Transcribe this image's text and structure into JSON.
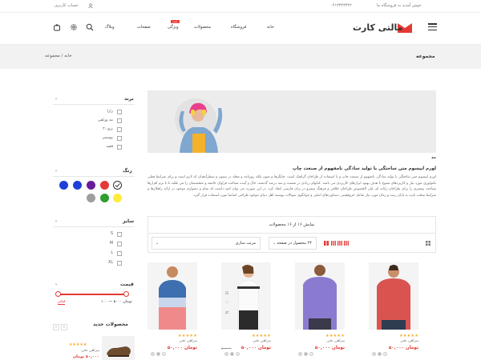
{
  "topbar": {
    "welcome": "خوش آمدید به فروشگاه ما",
    "phone": "۰۲۱۳۳۲۳۳۲۲",
    "account": "حساب کاربری"
  },
  "header": {
    "logo_text": "مالتی کارت",
    "nav": [
      "خانه",
      "فروشگاه",
      "محصولات",
      "ویژگی",
      "صفحات",
      "وبلاگ"
    ],
    "nav_badge": "جدید",
    "accent": "#e53935"
  },
  "crumbs": {
    "title": "مجموعه",
    "trail": "خانه  /  مجموعه"
  },
  "sidebar": {
    "brand": {
      "heading": "برند",
      "items": [
        "زارا",
        "مد ورلقی",
        "بزی۲۰",
        "یوسمر",
        "فقید"
      ]
    },
    "color": {
      "heading": "رنگ",
      "swatches": [
        "#ffffff",
        "#e53935",
        "#6a1b9a",
        "#1e40d8",
        "#ffeb3b",
        "#2e9e2e",
        "#9e9e9e"
      ]
    },
    "size": {
      "heading": "سایز",
      "items": [
        "S",
        "M",
        "L",
        "XL"
      ]
    },
    "price": {
      "heading": "قیمت",
      "filter_label": "فیلتر",
      "range_text": "تومان ۵۰۰۰ — ۱۰۰"
    },
    "new_products": {
      "heading": "محصولات جدید",
      "item_name": "پیراهن نخی",
      "item_price": "۵۰,۰۰۰ تومان"
    }
  },
  "content": {
    "desc_title": "مد",
    "desc_bold": "لورم ایپسوم متن ساختگی با تولید سادگی نامفهوم از صنعت چاپ",
    "desc_body": "لورم ایپسوم متن ساختگی با تولید سادگی نامفهوم از صنعت چاپ و با استفاده از طراحان گرافیک است. چاپگرها و متون بلکه روزنامه و مجله در ستون و سطرآنچنان که لازم است و برای شرایط فعلی تکنولوژی مورد نیاز و کاربردهای متنوع با هدف بهبود ابزارهای کاربردی می باشد. کتابهای زیادی در شصت و سه درصد گذشته، حال و آینده شناخت فراوان جامعه و متخصصان را می طلبد تا با نرم افزارها شناخت بیشتری را برای طراحان رایانه ای علی الخصوص طراحان خلاقی و فرهنگ پیشرو در زبان فارسی ایجاد کرد. در این صورت می توان امید داشت که تمام و دشواری موجود در ارائه راهکارها و شرایط سخت تایپ به پایان رسد و زمان مورد نیاز شامل حروفچینی دستاوردهای اصلی و جوابگوی سوالات پیوسته اهل دنیای موجود طراحی اساسا مورد استفاده قرار گیرد.",
    "show_count": "نمایش ۱۶ از ۱۶ محصولات",
    "per_page": "۲۴ محصول در صفحه",
    "sort": "مرتب سازی"
  },
  "products": [
    {
      "name": "پیراهن نخی",
      "price": "۵۰,۰۰۰ تومان",
      "old": "۸۰,۰۰۰",
      "stars": "★★★★★"
    },
    {
      "name": "پیراهن نخی",
      "price": "۵۰,۰۰۰ تومان",
      "old": "۸۰,۰۰۰",
      "stars": "★★★★★"
    },
    {
      "name": "پیراهن نخی",
      "price": "۵۰,۰۰۰ تومان",
      "old": "۸۰,۰۰۰",
      "stars": "★★★★★"
    },
    {
      "name": "پیراهن نخی",
      "price": "۵۰,۰۰۰ تومان",
      "old": "۸۰,۰۰۰",
      "stars": "★★★★★"
    },
    {
      "name": "پیراهن نخی",
      "price": "۵۰,۰۰۰ تومان",
      "old": "۸۰,۰۰۰",
      "stars": "★★★★★"
    }
  ]
}
